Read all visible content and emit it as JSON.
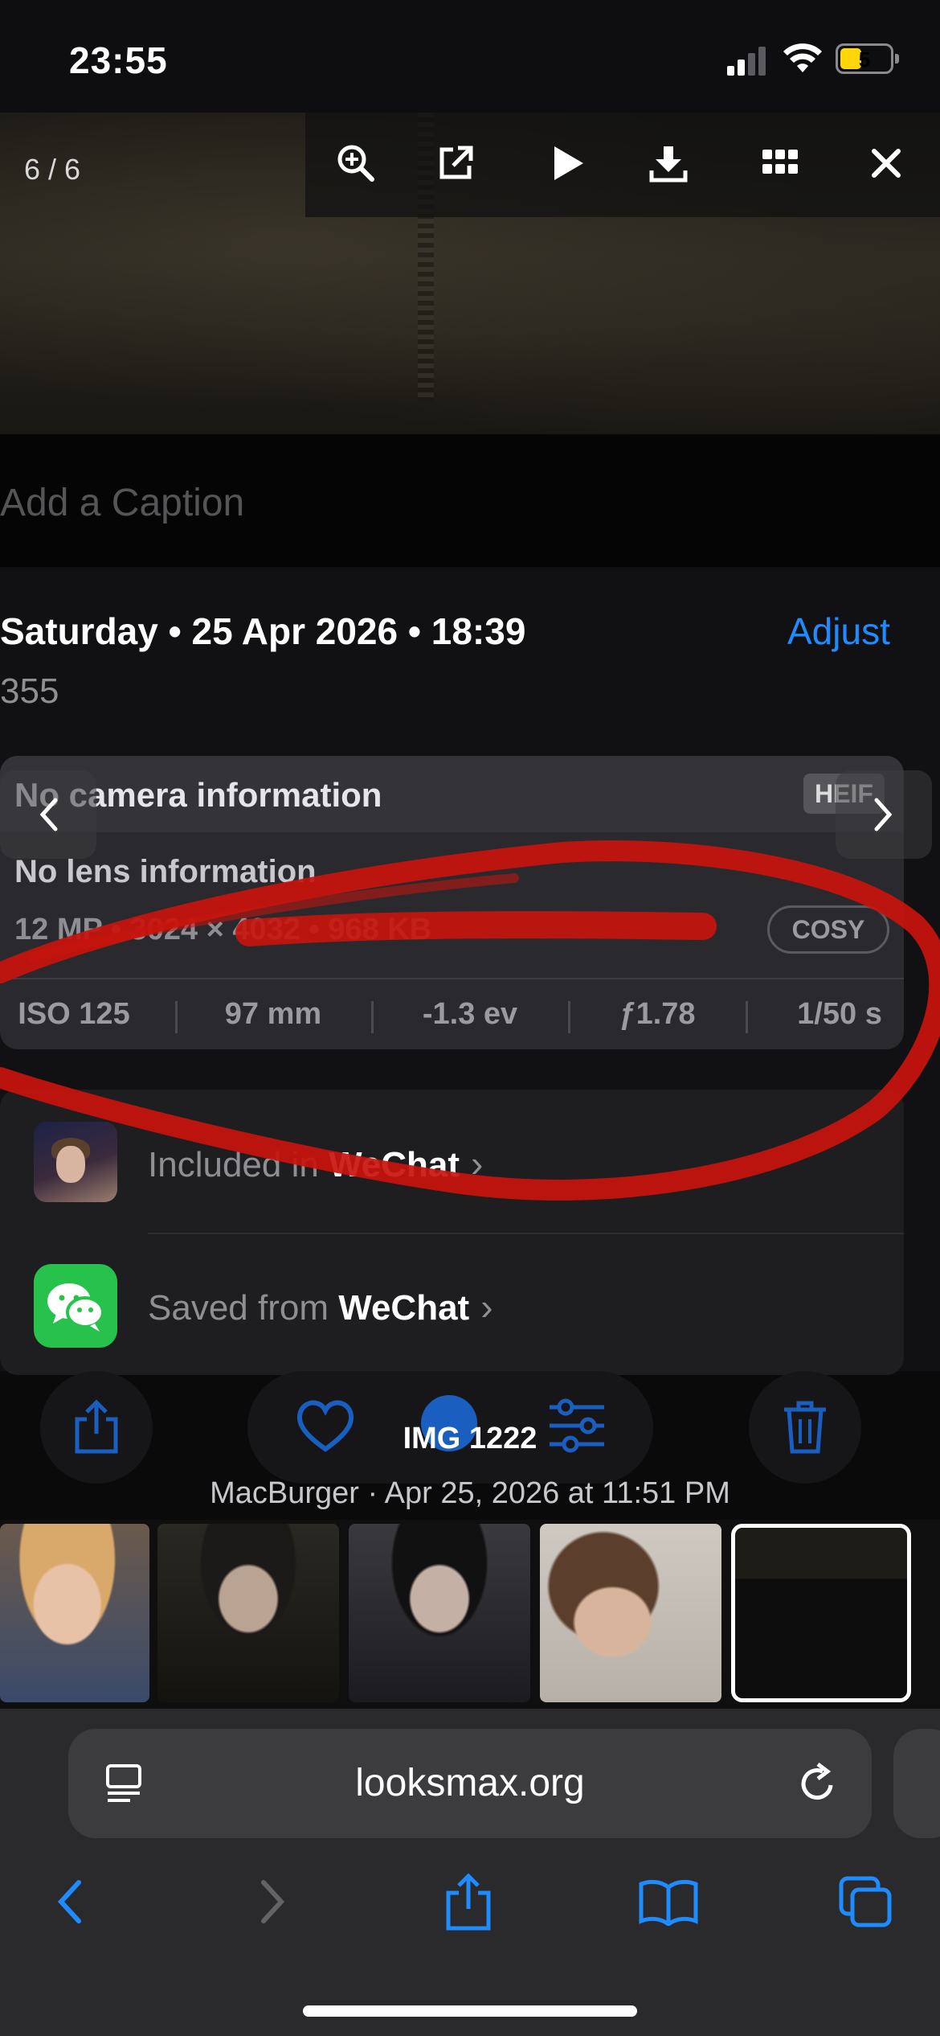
{
  "status_bar": {
    "time": "23:55",
    "battery": "5"
  },
  "viewer": {
    "counter": "6 / 6",
    "toolbar_icons": [
      "zoom-in-icon",
      "open-external-icon",
      "play-icon",
      "download-icon",
      "grid-icon",
      "close-icon"
    ]
  },
  "caption_placeholder": "Add a Caption",
  "info": {
    "date": "Saturday • 25 Apr 2026 • 18:39",
    "adjust_label": "Adjust",
    "number": "355"
  },
  "exif": {
    "camera": "No camera information",
    "format": "HEIF",
    "lens": "No lens information",
    "specs": "12 MP • 3024 × 4032 • 968 KB",
    "badge": "COSY",
    "iso": "ISO 125",
    "focal": "97 mm",
    "ev": "-1.3 ev",
    "aperture": "ƒ1.78",
    "shutter": "1/50 s"
  },
  "albums": {
    "included_prefix": "Included in ",
    "included_app": "WeChat",
    "saved_prefix": "Saved from ",
    "saved_app": "WeChat",
    "chevron": "›"
  },
  "image": {
    "title": "IMG 1222",
    "subtitle": "MacBurger · Apr 25, 2026 at 11:51 PM"
  },
  "safari": {
    "url": "looksmax.org"
  },
  "colors": {
    "accent": "#1e8cff",
    "annotation": "#c9140d",
    "wechat": "#27c24c"
  }
}
